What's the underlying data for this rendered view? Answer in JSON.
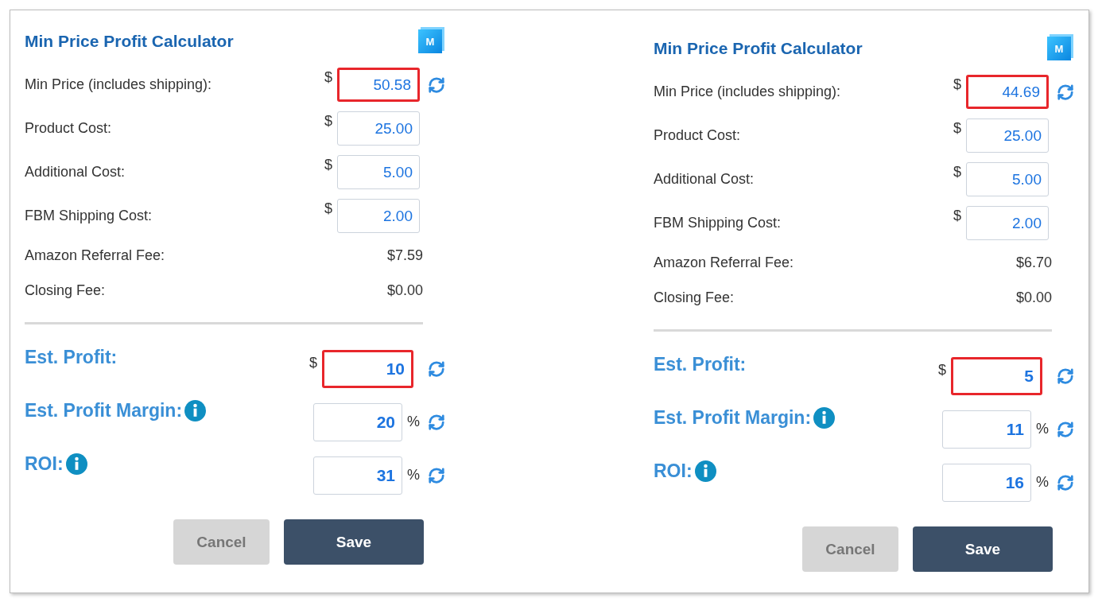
{
  "panels": [
    {
      "title": "Min Price Profit Calculator",
      "logo": "M",
      "rows": [
        {
          "kind": "input",
          "label": "Min Price (includes shipping):",
          "prefix": "$",
          "value": "50.58",
          "highlighted": true,
          "refresh": true
        },
        {
          "kind": "input",
          "label": "Product Cost:",
          "prefix": "$",
          "value": "25.00",
          "highlighted": false,
          "refresh": false
        },
        {
          "kind": "input",
          "label": "Additional Cost:",
          "prefix": "$",
          "value": "5.00",
          "highlighted": false,
          "refresh": false
        },
        {
          "kind": "input",
          "label": "FBM Shipping Cost:",
          "prefix": "$",
          "value": "2.00",
          "highlighted": false,
          "refresh": false
        },
        {
          "kind": "fee",
          "label": "Amazon Referral Fee:",
          "value": "$7.59"
        },
        {
          "kind": "fee",
          "label": "Closing Fee:",
          "value": "$0.00"
        }
      ],
      "results": [
        {
          "label": "Est. Profit:",
          "info": false,
          "prefix": "$",
          "value": "10",
          "highlighted": true
        },
        {
          "label": "Est. Profit Margin:",
          "info": true,
          "suffix": "%",
          "value": "20",
          "highlighted": false
        },
        {
          "label": "ROI:",
          "info": true,
          "suffix": "%",
          "value": "31",
          "highlighted": false
        }
      ],
      "buttons": [
        {
          "label": "Cancel",
          "disabled": true
        },
        {
          "label": "Save",
          "disabled": false
        }
      ]
    },
    {
      "title": "Min Price Profit Calculator",
      "logo": "M",
      "rows": [
        {
          "kind": "input",
          "label": "Min Price (includes shipping):",
          "prefix": "$",
          "value": "44.69",
          "highlighted": true,
          "refresh": true
        },
        {
          "kind": "input",
          "label": "Product Cost:",
          "prefix": "$",
          "value": "25.00",
          "highlighted": false,
          "refresh": false
        },
        {
          "kind": "input",
          "label": "Additional Cost:",
          "prefix": "$",
          "value": "5.00",
          "highlighted": false,
          "refresh": false
        },
        {
          "kind": "input",
          "label": "FBM Shipping Cost:",
          "prefix": "$",
          "value": "2.00",
          "highlighted": false,
          "refresh": false
        },
        {
          "kind": "fee",
          "label": "Amazon Referral Fee:",
          "value": "$6.70"
        },
        {
          "kind": "fee",
          "label": "Closing Fee:",
          "value": "$0.00"
        }
      ],
      "results": [
        {
          "label": "Est. Profit:",
          "info": false,
          "prefix": "$",
          "value": "5",
          "highlighted": true
        },
        {
          "label": "Est. Profit Margin:",
          "info": true,
          "suffix": "%",
          "value": "11",
          "highlighted": false
        },
        {
          "label": "ROI:",
          "info": true,
          "suffix": "%",
          "value": "16",
          "highlighted": false
        }
      ],
      "buttons": [
        {
          "label": "Cancel",
          "disabled": true
        },
        {
          "label": "Save",
          "disabled": false
        }
      ]
    }
  ]
}
